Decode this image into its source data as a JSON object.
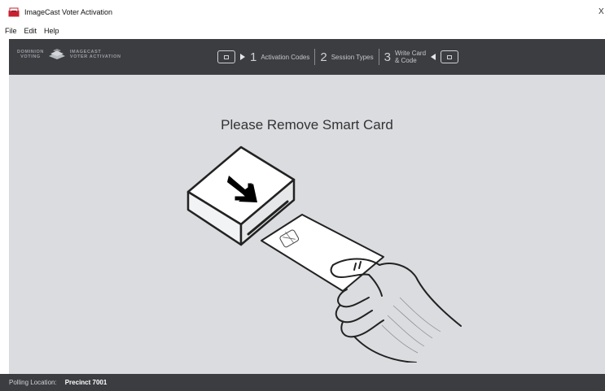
{
  "window": {
    "title": "ImageCast Voter Activation",
    "close_glyph": "X",
    "icon": "ballot-box-icon"
  },
  "menu": {
    "items": [
      "File",
      "Edit",
      "Help"
    ]
  },
  "brand": {
    "left_line1": "DOMINION",
    "left_line2": "VOTING",
    "right_line1": "IMAGECAST",
    "right_line2": "VOTER ACTIVATION"
  },
  "steps": [
    {
      "number": "1",
      "label": "Activation Codes"
    },
    {
      "number": "2",
      "label": "Session Types"
    },
    {
      "number": "3",
      "label_line1": "Write Card",
      "label_line2": "& Code"
    }
  ],
  "main": {
    "prompt": "Please Remove Smart Card",
    "illustration": "hand-removing-smart-card-from-reader"
  },
  "status": {
    "label": "Polling Location:",
    "value": "Precinct 7001"
  },
  "colors": {
    "header_bg": "#3b3d41",
    "content_bg": "#dadcdf",
    "accent_red": "#c8202f"
  }
}
